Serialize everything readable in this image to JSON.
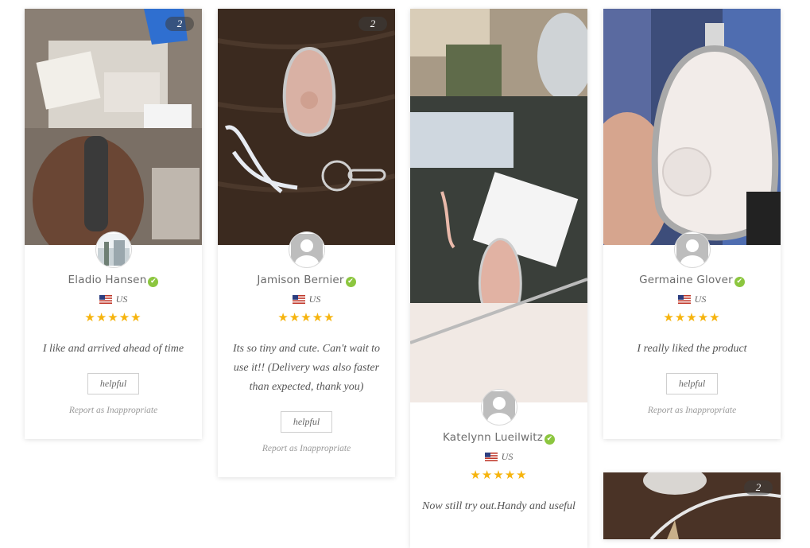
{
  "reviews": [
    {
      "name": "Eladio Hansen",
      "country": "US",
      "stars": "★★★★★",
      "text": "I like and arrived ahead of time",
      "helpful": "helpful",
      "report": "Report as Inappropriate",
      "photo_count": "2"
    },
    {
      "name": "Jamison Bernier",
      "country": "US",
      "stars": "★★★★★",
      "text": "Its so tiny and cute. Can't wait to use it!! (Delivery was also faster than expected, thank you)",
      "helpful": "helpful",
      "report": "Report as Inappropriate",
      "photo_count": "2"
    },
    {
      "name": "Katelynn Lueilwitz",
      "country": "US",
      "stars": "★★★★★",
      "text": "Now still try out.Handy and useful"
    },
    {
      "name": "Germaine Glover",
      "country": "US",
      "stars": "★★★★★",
      "text": "I really liked the product",
      "helpful": "helpful",
      "report": "Report as Inappropriate"
    },
    {
      "photo_count": "2"
    }
  ],
  "colors": {
    "star": "#f6b40e",
    "verified": "#8cc63f",
    "text": "#555555"
  }
}
